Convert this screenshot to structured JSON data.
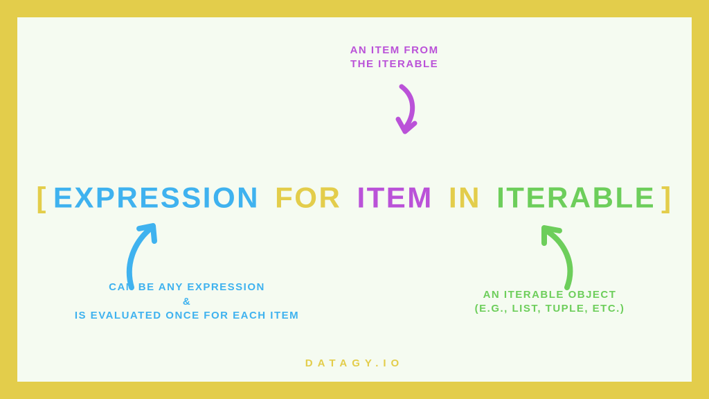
{
  "annotations": {
    "item": {
      "line1": "AN ITEM FROM",
      "line2": "THE ITERABLE"
    },
    "expression": {
      "line1": "CAN BE ANY EXPRESSION",
      "amp": "&",
      "line2": "IS EVALUATED ONCE FOR EACH ITEM"
    },
    "iterable": {
      "line1": "AN ITERABLE OBJECT",
      "line2": "(E.G., LIST, TUPLE, ETC.)"
    }
  },
  "syntax": {
    "bracket_open": "[",
    "expression": "EXPRESSION",
    "for": "FOR",
    "item": "ITEM",
    "in": "IN",
    "iterable": "ITERABLE",
    "bracket_close": "]"
  },
  "footer": "DATAGY.IO",
  "colors": {
    "border": "#e3cd4b",
    "bg": "#f5fbf1",
    "blue": "#3fb2ef",
    "yellow": "#e3cd4b",
    "purple": "#ba52d8",
    "green": "#6dce5b"
  }
}
